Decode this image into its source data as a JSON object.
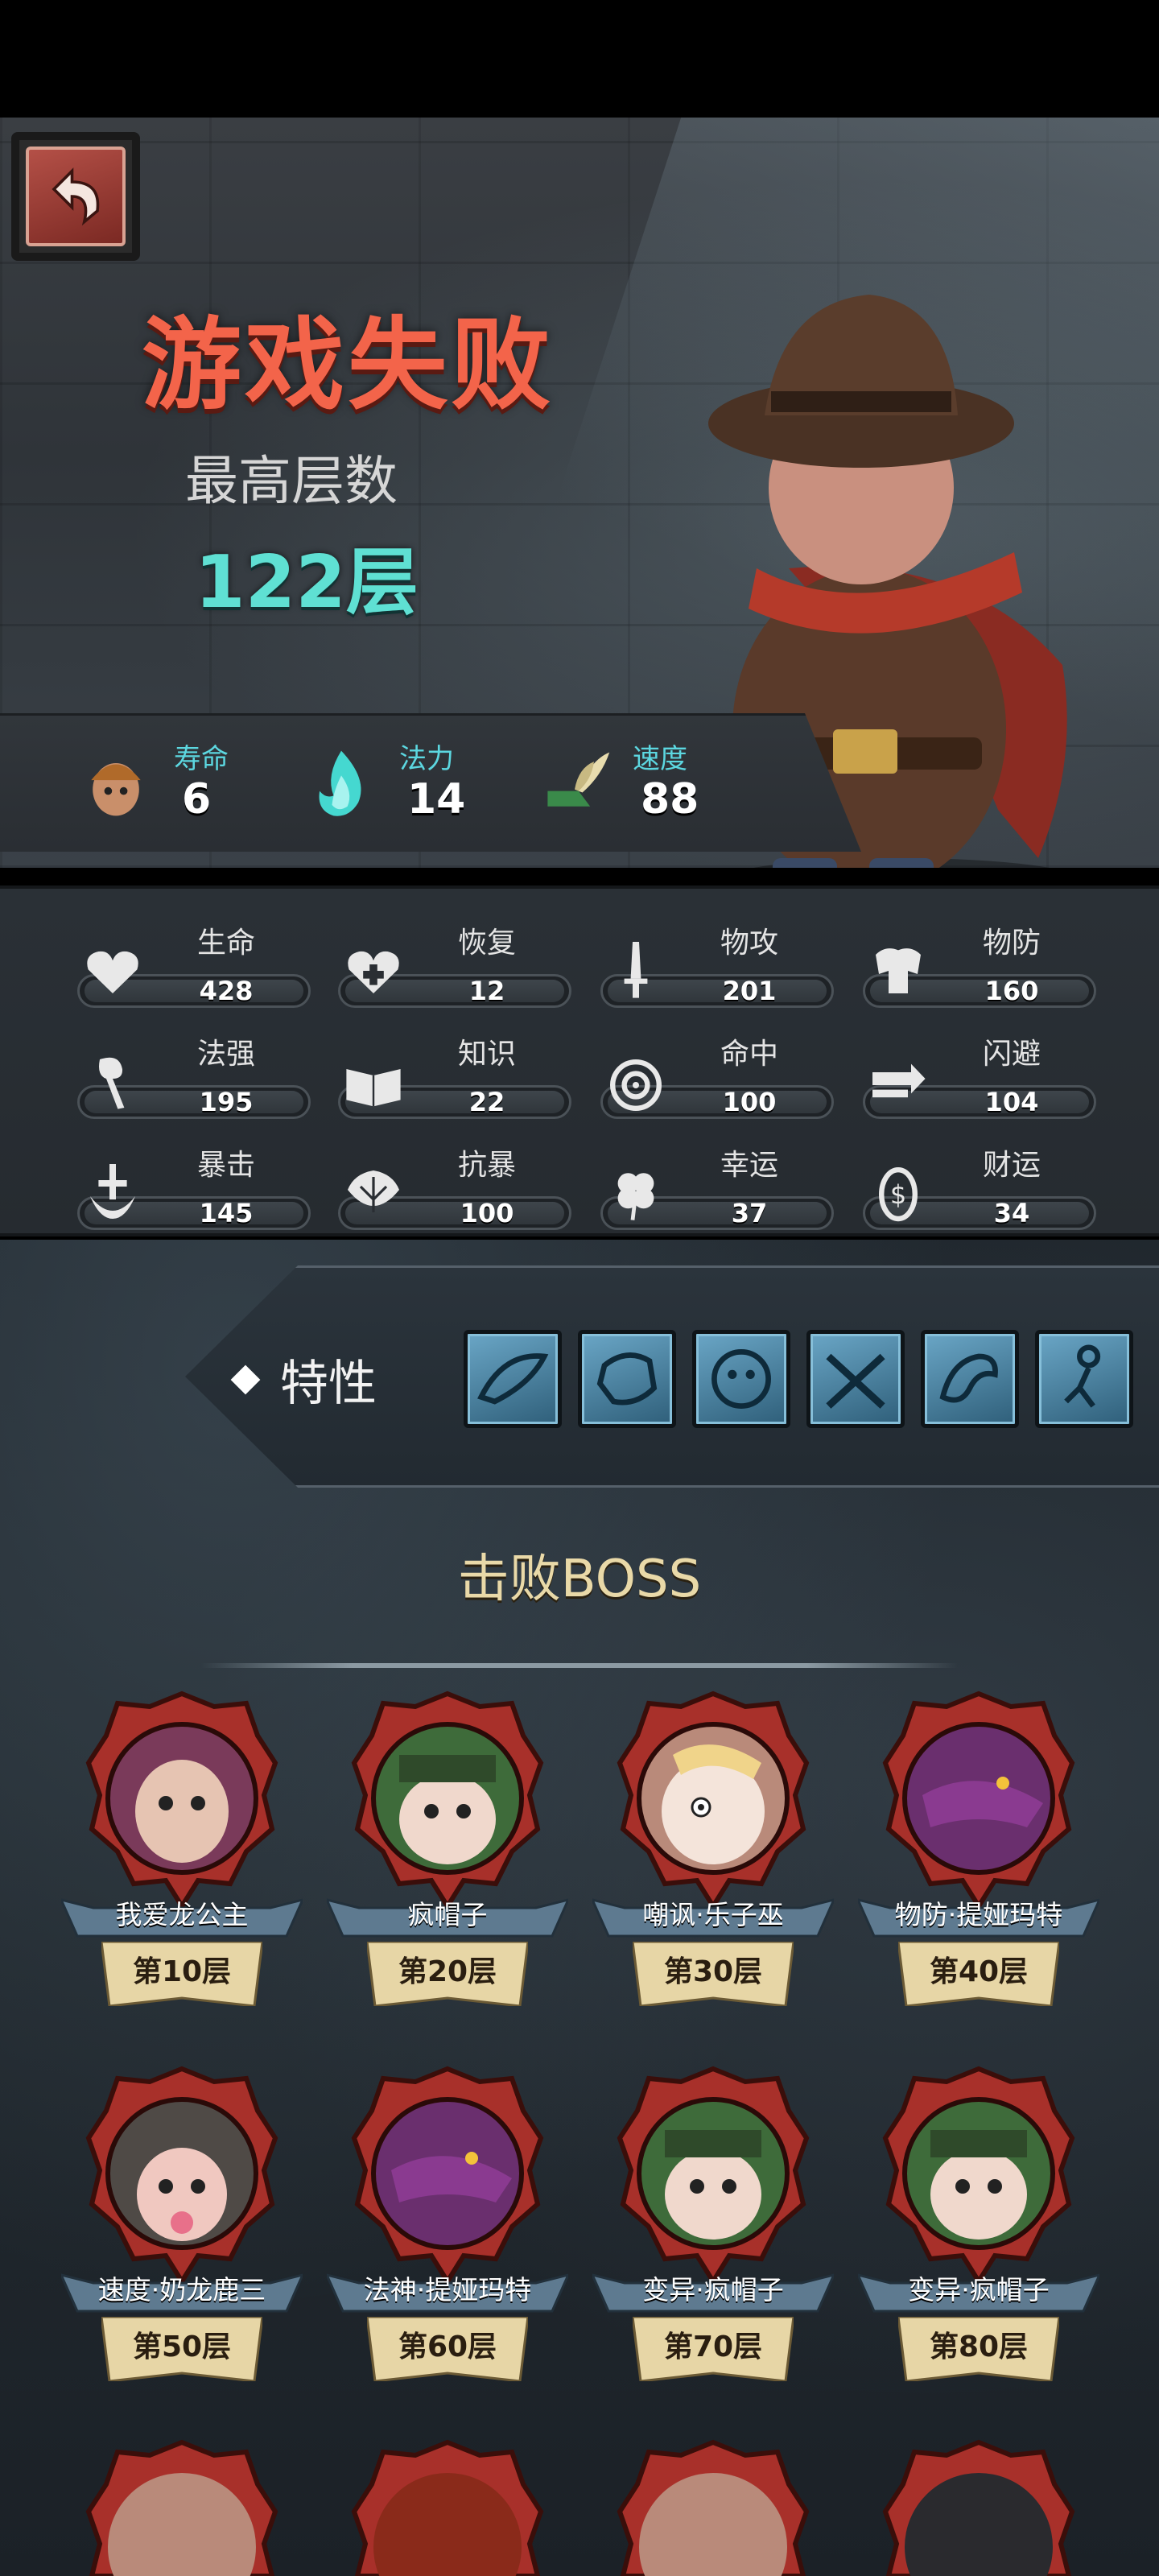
{
  "header": {
    "title": "游戏失败",
    "subtitle": "最高层数",
    "floor_value": "122层"
  },
  "base_stats": [
    {
      "icon": "lifespan-head-icon",
      "label": "寿命",
      "value": "6"
    },
    {
      "icon": "mana-flame-icon",
      "label": "法力",
      "value": "14"
    },
    {
      "icon": "winged-boot-icon",
      "label": "速度",
      "value": "88"
    }
  ],
  "attributes": [
    {
      "icon": "heart-icon",
      "label": "生命",
      "value": "428"
    },
    {
      "icon": "heal-heart-icon",
      "label": "恢复",
      "value": "12"
    },
    {
      "icon": "sword-icon",
      "label": "物攻",
      "value": "201"
    },
    {
      "icon": "armor-icon",
      "label": "物防",
      "value": "160"
    },
    {
      "icon": "staff-icon",
      "label": "法强",
      "value": "195"
    },
    {
      "icon": "book-icon",
      "label": "知识",
      "value": "22"
    },
    {
      "icon": "target-icon",
      "label": "命中",
      "value": "100"
    },
    {
      "icon": "dodge-arrows-icon",
      "label": "闪避",
      "value": "104"
    },
    {
      "icon": "crit-blade-icon",
      "label": "暴击",
      "value": "145"
    },
    {
      "icon": "shield-leaf-icon",
      "label": "抗暴",
      "value": "100"
    },
    {
      "icon": "clover-icon",
      "label": "幸运",
      "value": "37"
    },
    {
      "icon": "coin-icon",
      "label": "财运",
      "value": "34"
    }
  ],
  "traits": {
    "label": "特性",
    "icons": [
      "trait-feather-icon",
      "trait-fist-icon",
      "trait-beast-icon",
      "trait-crossed-guns-icon",
      "trait-arm-icon",
      "trait-figure-icon"
    ]
  },
  "bosses": {
    "heading": "击败BOSS",
    "items": [
      {
        "name": "我爱龙公主",
        "floor": "第10层",
        "color": "#7a3a5a"
      },
      {
        "name": "疯帽子",
        "floor": "第20层",
        "color": "#3e6b3a"
      },
      {
        "name": "嘲讽·乐子巫",
        "floor": "第30层",
        "color": "#b98a7a"
      },
      {
        "name": "物防·提娅玛特",
        "floor": "第40层",
        "color": "#6a2f6e"
      },
      {
        "name": "速度·奶龙鹿三",
        "floor": "第50层",
        "color": "#4f4a46"
      },
      {
        "name": "法神·提娅玛特",
        "floor": "第60层",
        "color": "#6a2f6e"
      },
      {
        "name": "变异·疯帽子",
        "floor": "第70层",
        "color": "#3e6b3a"
      },
      {
        "name": "变异·疯帽子",
        "floor": "第80层",
        "color": "#3e6b3a"
      }
    ]
  },
  "colors": {
    "title": "#f3644a",
    "floor_value": "#5fe0d3",
    "stat_label": "#5cd7e0",
    "boss_heading": "#e9d9a8",
    "medal_red": "#a8302a"
  }
}
